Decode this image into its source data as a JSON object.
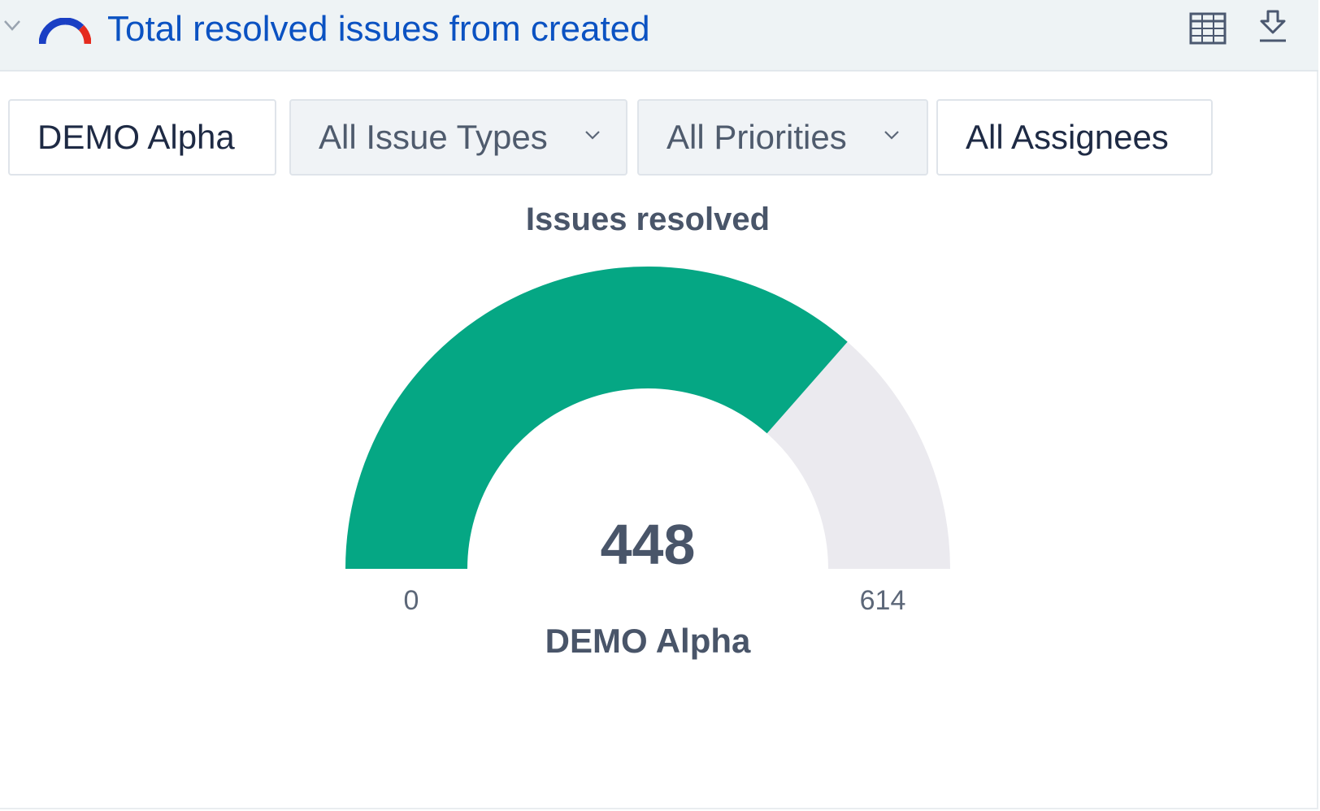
{
  "header": {
    "title": "Total resolved issues from created",
    "icons": [
      "chevron-down-icon",
      "gauge-icon",
      "table-icon",
      "download-icon"
    ]
  },
  "filters": {
    "project": "DEMO Alpha",
    "issue_types": "All Issue Types",
    "priorities": "All Priorities",
    "assignees": "All Assignees"
  },
  "chart_data": {
    "type": "gauge",
    "title": "Issues resolved",
    "value": 448,
    "min": 0,
    "max": 614,
    "min_label": "0",
    "max_label": "614",
    "value_label": "448",
    "category": "DEMO Alpha",
    "colors": {
      "fill": "#05a784",
      "track": "#ebeaef",
      "text": "#495569"
    }
  }
}
